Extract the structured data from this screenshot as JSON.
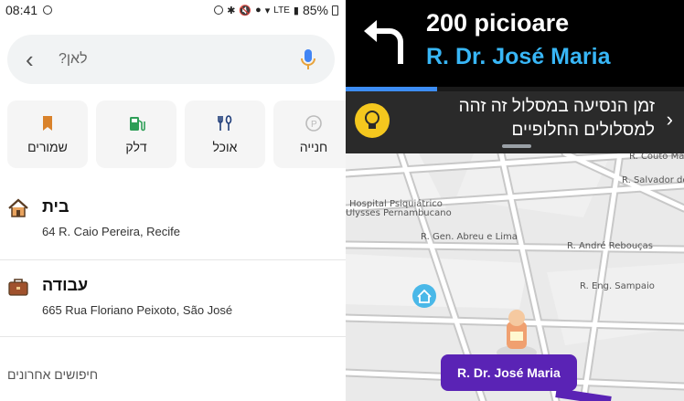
{
  "status": {
    "time": "08:41",
    "battery": "85%",
    "network": "LTE"
  },
  "search": {
    "placeholder": "לאן?"
  },
  "categories": [
    {
      "label": "שמורים",
      "icon": "bookmark-icon"
    },
    {
      "label": "דלק",
      "icon": "fuel-icon"
    },
    {
      "label": "אוכל",
      "icon": "food-icon"
    },
    {
      "label": "חנייה",
      "icon": "parking-icon"
    }
  ],
  "places": [
    {
      "name": "בית",
      "address": "64 R. Caio Pereira, Recife",
      "icon": "home-icon"
    },
    {
      "name": "עבודה",
      "address": "665 Rua Floriano Peixoto, São José",
      "icon": "briefcase-icon"
    }
  ],
  "recent_label": "חיפושים אחרונים",
  "nav": {
    "distance": "200 picioare",
    "street": "R. Dr. José Maria",
    "progress": 0.27,
    "notice": "זמן הנסיעה במסלול זה זהה למסלולים החלופיים",
    "colors": {
      "street": "#38b6f6",
      "progress": "#3d8df5",
      "bulb": "#f4c71e",
      "pill": "#5a23b5"
    }
  },
  "map": {
    "labels": {
      "hospital_1": "Hospital Psiquiátrico",
      "hospital_2": "Ulysses Pernambucano",
      "abreu": "R. Gen. Abreu e Lima",
      "reboucas": "R. André Rebouças",
      "sampaio": "R. Eng. Sampaio",
      "salvador": "R. Salvador de",
      "couto": "R. Couto Ma"
    },
    "current_street": "R. Dr. José Maria"
  }
}
